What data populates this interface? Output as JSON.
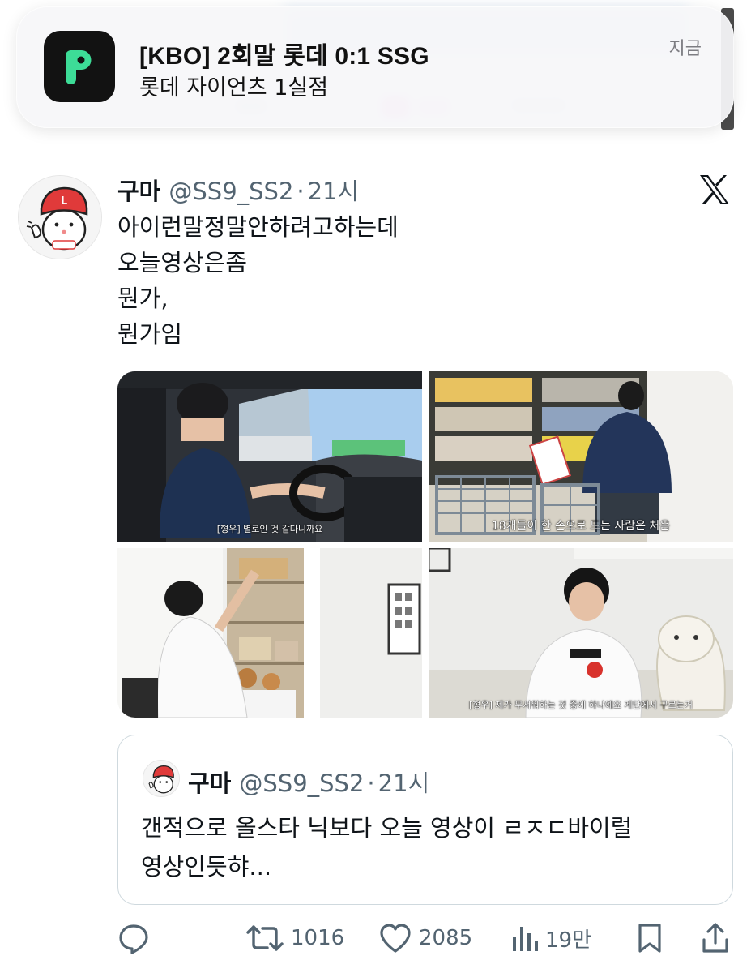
{
  "notification": {
    "title": "[KBO] 2회말 롯데 0:1 SSG",
    "body": "롯데 자이언츠 1실점",
    "time": "지금",
    "app_icon": "r-app-icon",
    "icon_color": "#3ddc97"
  },
  "tweet": {
    "author": "구마",
    "handle": "@SS9_SS2",
    "dot": "·",
    "time": "21시",
    "lines": [
      "아이런말정말안하려고하는데",
      "오늘영상은좀",
      "뭔가,",
      "뭔가임"
    ],
    "media": [
      {
        "caption": "[형우] 별로인 것 같다니까요"
      },
      {
        "caption": "18개들이 한 손으로 드는 사람은 처음"
      },
      {
        "caption": ""
      },
      {
        "caption": "[형우] 제가 무서워하는 것 중에 하나예요 계단에서 구르는거"
      }
    ]
  },
  "quote": {
    "author": "구마",
    "handle": "@SS9_SS2",
    "dot": "·",
    "time": "21시",
    "lines": [
      "갠적으로 올스타 닉보다 오늘 영상이 ㄹㅈㄷ바이럴",
      "영상인듯햐..."
    ]
  },
  "actions": {
    "retweets": "1016",
    "likes": "2085",
    "views": "19만"
  },
  "colors": {
    "text": "#0f1419",
    "secondary": "#536471",
    "border": "#cfd9de"
  }
}
